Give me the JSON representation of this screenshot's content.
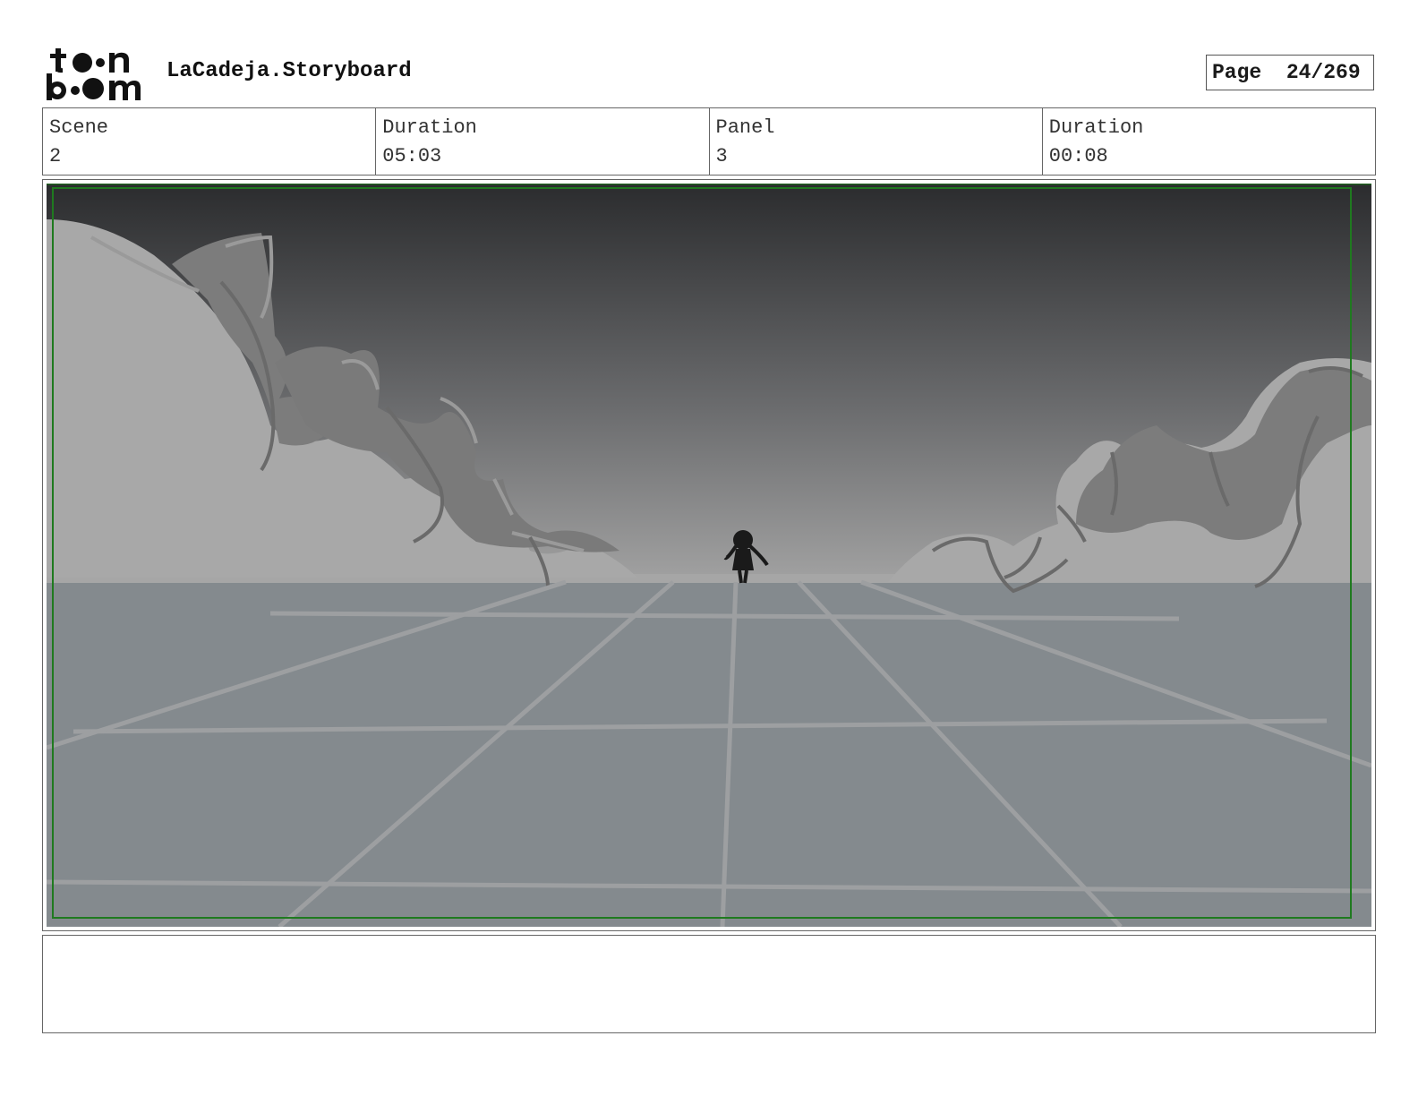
{
  "header": {
    "logo_text_top": "t●●n",
    "logo_text_bottom": "b●●m",
    "title": "LaCadeja.Storyboard",
    "page_label": "Page",
    "page_number": "24/269"
  },
  "info": {
    "scene_label": "Scene",
    "scene_value": "2",
    "scene_duration_label": "Duration",
    "scene_duration_value": "05:03",
    "panel_label": "Panel",
    "panel_value": "3",
    "panel_duration_label": "Duration",
    "panel_duration_value": "00:08"
  },
  "panel_image": {
    "description_icon": "storyboard-sketch",
    "colors": {
      "sky_top": "#2b2c2e",
      "sky_bottom": "#9c9c9c",
      "ground": "#848a8e",
      "cliffs": "#a8a8a8",
      "safe_area": "#1f7a1f"
    }
  },
  "notes": {
    "text": ""
  }
}
